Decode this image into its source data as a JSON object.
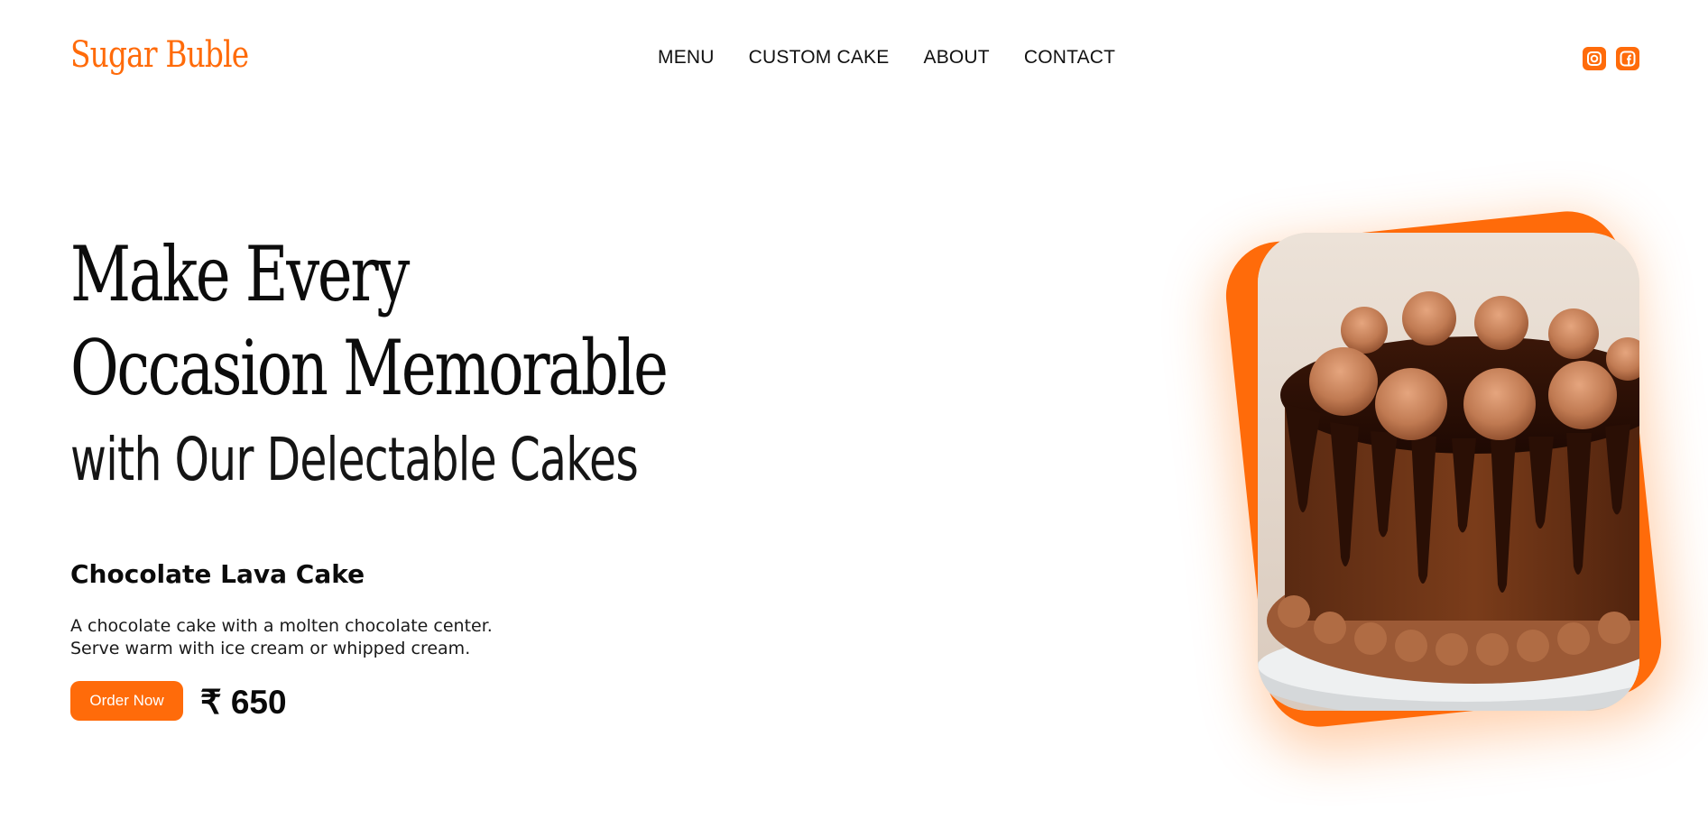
{
  "brand": {
    "name": "Sugar Buble",
    "accent": "#ff6b0a"
  },
  "nav": {
    "items": [
      {
        "label": "MENU"
      },
      {
        "label": "CUSTOM CAKE"
      },
      {
        "label": "ABOUT"
      },
      {
        "label": "CONTACT"
      }
    ]
  },
  "social": {
    "icons": [
      "instagram-icon",
      "facebook-icon"
    ]
  },
  "hero": {
    "line1": "Make Every",
    "line2": "Occasion Memorable",
    "line3": "with Our Delectable Cakes"
  },
  "product": {
    "name": "Chocolate Lava Cake",
    "desc_line1": "A chocolate cake with a molten chocolate center.",
    "desc_line2": "Serve warm with ice cream or whipped cream.",
    "order_label": "Order Now",
    "price": "₹ 650"
  }
}
